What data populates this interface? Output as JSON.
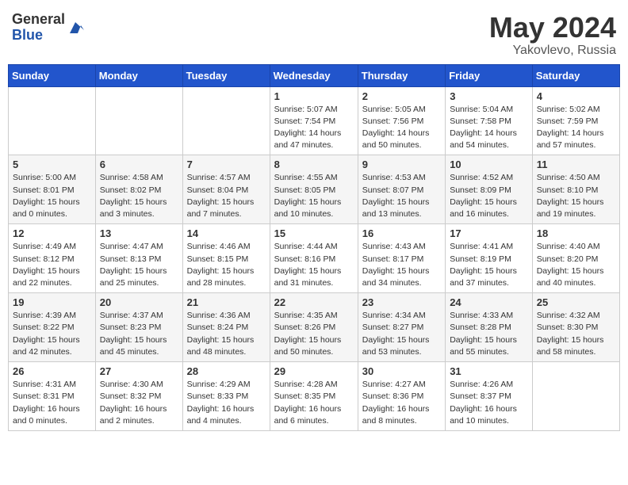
{
  "logo": {
    "general": "General",
    "blue": "Blue"
  },
  "title": {
    "month_year": "May 2024",
    "location": "Yakovlevo, Russia"
  },
  "headers": [
    "Sunday",
    "Monday",
    "Tuesday",
    "Wednesday",
    "Thursday",
    "Friday",
    "Saturday"
  ],
  "weeks": [
    [
      {
        "day": "",
        "sunrise": "",
        "sunset": "",
        "daylight": ""
      },
      {
        "day": "",
        "sunrise": "",
        "sunset": "",
        "daylight": ""
      },
      {
        "day": "",
        "sunrise": "",
        "sunset": "",
        "daylight": ""
      },
      {
        "day": "1",
        "sunrise": "Sunrise: 5:07 AM",
        "sunset": "Sunset: 7:54 PM",
        "daylight": "Daylight: 14 hours and 47 minutes."
      },
      {
        "day": "2",
        "sunrise": "Sunrise: 5:05 AM",
        "sunset": "Sunset: 7:56 PM",
        "daylight": "Daylight: 14 hours and 50 minutes."
      },
      {
        "day": "3",
        "sunrise": "Sunrise: 5:04 AM",
        "sunset": "Sunset: 7:58 PM",
        "daylight": "Daylight: 14 hours and 54 minutes."
      },
      {
        "day": "4",
        "sunrise": "Sunrise: 5:02 AM",
        "sunset": "Sunset: 7:59 PM",
        "daylight": "Daylight: 14 hours and 57 minutes."
      }
    ],
    [
      {
        "day": "5",
        "sunrise": "Sunrise: 5:00 AM",
        "sunset": "Sunset: 8:01 PM",
        "daylight": "Daylight: 15 hours and 0 minutes."
      },
      {
        "day": "6",
        "sunrise": "Sunrise: 4:58 AM",
        "sunset": "Sunset: 8:02 PM",
        "daylight": "Daylight: 15 hours and 3 minutes."
      },
      {
        "day": "7",
        "sunrise": "Sunrise: 4:57 AM",
        "sunset": "Sunset: 8:04 PM",
        "daylight": "Daylight: 15 hours and 7 minutes."
      },
      {
        "day": "8",
        "sunrise": "Sunrise: 4:55 AM",
        "sunset": "Sunset: 8:05 PM",
        "daylight": "Daylight: 15 hours and 10 minutes."
      },
      {
        "day": "9",
        "sunrise": "Sunrise: 4:53 AM",
        "sunset": "Sunset: 8:07 PM",
        "daylight": "Daylight: 15 hours and 13 minutes."
      },
      {
        "day": "10",
        "sunrise": "Sunrise: 4:52 AM",
        "sunset": "Sunset: 8:09 PM",
        "daylight": "Daylight: 15 hours and 16 minutes."
      },
      {
        "day": "11",
        "sunrise": "Sunrise: 4:50 AM",
        "sunset": "Sunset: 8:10 PM",
        "daylight": "Daylight: 15 hours and 19 minutes."
      }
    ],
    [
      {
        "day": "12",
        "sunrise": "Sunrise: 4:49 AM",
        "sunset": "Sunset: 8:12 PM",
        "daylight": "Daylight: 15 hours and 22 minutes."
      },
      {
        "day": "13",
        "sunrise": "Sunrise: 4:47 AM",
        "sunset": "Sunset: 8:13 PM",
        "daylight": "Daylight: 15 hours and 25 minutes."
      },
      {
        "day": "14",
        "sunrise": "Sunrise: 4:46 AM",
        "sunset": "Sunset: 8:15 PM",
        "daylight": "Daylight: 15 hours and 28 minutes."
      },
      {
        "day": "15",
        "sunrise": "Sunrise: 4:44 AM",
        "sunset": "Sunset: 8:16 PM",
        "daylight": "Daylight: 15 hours and 31 minutes."
      },
      {
        "day": "16",
        "sunrise": "Sunrise: 4:43 AM",
        "sunset": "Sunset: 8:17 PM",
        "daylight": "Daylight: 15 hours and 34 minutes."
      },
      {
        "day": "17",
        "sunrise": "Sunrise: 4:41 AM",
        "sunset": "Sunset: 8:19 PM",
        "daylight": "Daylight: 15 hours and 37 minutes."
      },
      {
        "day": "18",
        "sunrise": "Sunrise: 4:40 AM",
        "sunset": "Sunset: 8:20 PM",
        "daylight": "Daylight: 15 hours and 40 minutes."
      }
    ],
    [
      {
        "day": "19",
        "sunrise": "Sunrise: 4:39 AM",
        "sunset": "Sunset: 8:22 PM",
        "daylight": "Daylight: 15 hours and 42 minutes."
      },
      {
        "day": "20",
        "sunrise": "Sunrise: 4:37 AM",
        "sunset": "Sunset: 8:23 PM",
        "daylight": "Daylight: 15 hours and 45 minutes."
      },
      {
        "day": "21",
        "sunrise": "Sunrise: 4:36 AM",
        "sunset": "Sunset: 8:24 PM",
        "daylight": "Daylight: 15 hours and 48 minutes."
      },
      {
        "day": "22",
        "sunrise": "Sunrise: 4:35 AM",
        "sunset": "Sunset: 8:26 PM",
        "daylight": "Daylight: 15 hours and 50 minutes."
      },
      {
        "day": "23",
        "sunrise": "Sunrise: 4:34 AM",
        "sunset": "Sunset: 8:27 PM",
        "daylight": "Daylight: 15 hours and 53 minutes."
      },
      {
        "day": "24",
        "sunrise": "Sunrise: 4:33 AM",
        "sunset": "Sunset: 8:28 PM",
        "daylight": "Daylight: 15 hours and 55 minutes."
      },
      {
        "day": "25",
        "sunrise": "Sunrise: 4:32 AM",
        "sunset": "Sunset: 8:30 PM",
        "daylight": "Daylight: 15 hours and 58 minutes."
      }
    ],
    [
      {
        "day": "26",
        "sunrise": "Sunrise: 4:31 AM",
        "sunset": "Sunset: 8:31 PM",
        "daylight": "Daylight: 16 hours and 0 minutes."
      },
      {
        "day": "27",
        "sunrise": "Sunrise: 4:30 AM",
        "sunset": "Sunset: 8:32 PM",
        "daylight": "Daylight: 16 hours and 2 minutes."
      },
      {
        "day": "28",
        "sunrise": "Sunrise: 4:29 AM",
        "sunset": "Sunset: 8:33 PM",
        "daylight": "Daylight: 16 hours and 4 minutes."
      },
      {
        "day": "29",
        "sunrise": "Sunrise: 4:28 AM",
        "sunset": "Sunset: 8:35 PM",
        "daylight": "Daylight: 16 hours and 6 minutes."
      },
      {
        "day": "30",
        "sunrise": "Sunrise: 4:27 AM",
        "sunset": "Sunset: 8:36 PM",
        "daylight": "Daylight: 16 hours and 8 minutes."
      },
      {
        "day": "31",
        "sunrise": "Sunrise: 4:26 AM",
        "sunset": "Sunset: 8:37 PM",
        "daylight": "Daylight: 16 hours and 10 minutes."
      },
      {
        "day": "",
        "sunrise": "",
        "sunset": "",
        "daylight": ""
      }
    ]
  ]
}
